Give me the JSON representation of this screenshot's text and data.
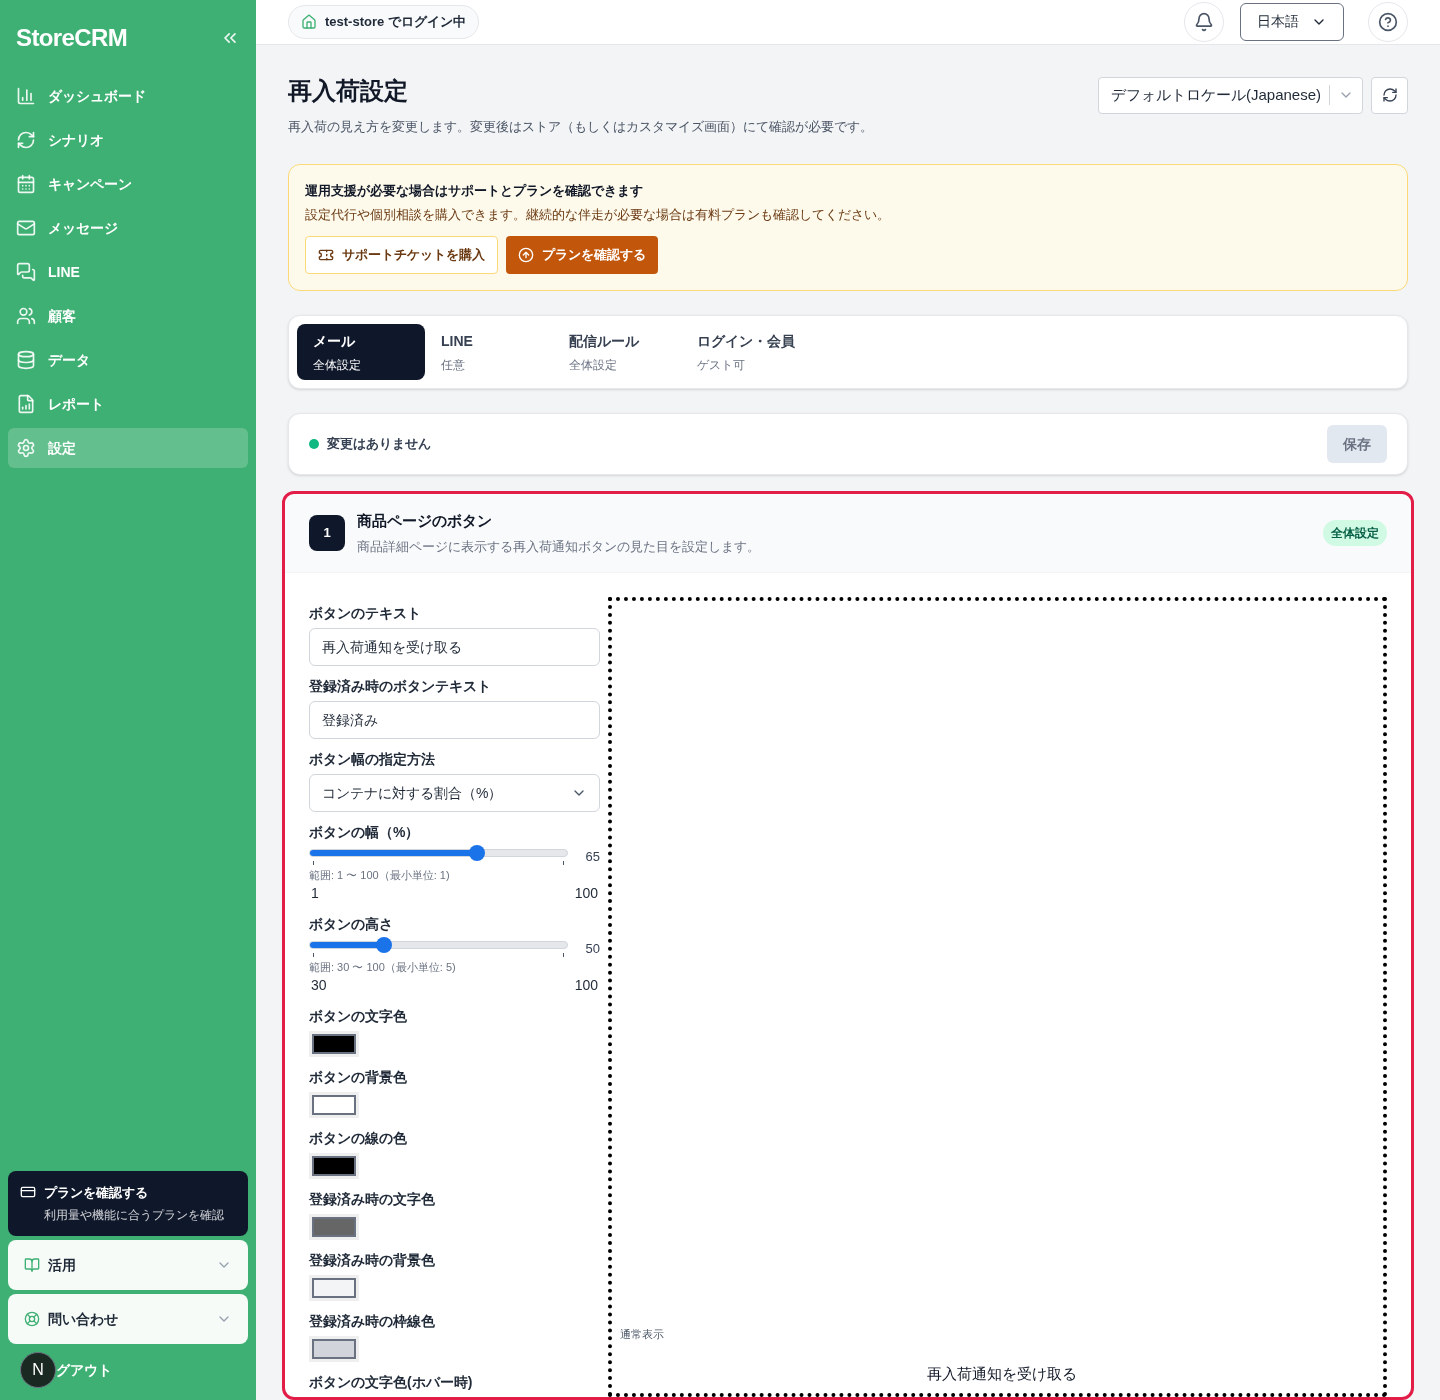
{
  "sidebar": {
    "logo": "StoreCRM",
    "items": [
      {
        "label": "ダッシュボード",
        "selected": false
      },
      {
        "label": "シナリオ",
        "selected": false
      },
      {
        "label": "キャンペーン",
        "selected": false
      },
      {
        "label": "メッセージ",
        "selected": false
      },
      {
        "label": "LINE",
        "selected": false
      },
      {
        "label": "顧客",
        "selected": false
      },
      {
        "label": "データ",
        "selected": false
      },
      {
        "label": "レポート",
        "selected": false
      },
      {
        "label": "設定",
        "selected": true
      }
    ],
    "plan_card": {
      "title": "プランを確認する",
      "subtitle": "利用量や機能に合うプランを確認"
    },
    "accordions": [
      {
        "label": "活用",
        "expanded": false
      },
      {
        "label": "問い合わせ",
        "expanded": false
      }
    ],
    "avatar": "N",
    "logout": "グアウト"
  },
  "header": {
    "store_badge": "test-store でログイン中",
    "language": "日本語"
  },
  "page": {
    "title": "再入荷設定",
    "description": "再入荷の見え方を変更します。変更後はストア（もしくはカスタマイズ画面）にて確認が必要です。",
    "locale_select": "デフォルトロケール(Japanese)"
  },
  "notice": {
    "title": "運用支援が必要な場合はサポートとプランを確認できます",
    "body": "設定代行や個別相談を購入できます。継続的な伴走が必要な場合は有料プランも確認してください。",
    "buttons": [
      {
        "label": "サポートチケットを購入",
        "kind": "outline"
      },
      {
        "label": "プランを確認する",
        "kind": "primary"
      }
    ]
  },
  "tabs": [
    {
      "title": "メール",
      "subtitle": "全体設定",
      "selected": true
    },
    {
      "title": "LINE",
      "subtitle": "任意",
      "selected": false
    },
    {
      "title": "配信ルール",
      "subtitle": "全体設定",
      "selected": false
    },
    {
      "title": "ログイン・会員",
      "subtitle": "ゲスト可",
      "selected": false
    }
  ],
  "status": {
    "text": "変更はありません",
    "color": "#10b981",
    "save": "保存",
    "disabled": true
  },
  "section": {
    "number": "1",
    "title": "商品ページのボタン",
    "description": "商品詳細ページに表示する再入荷通知ボタンの見た目を設定します。",
    "badge": "全体設定",
    "fields": [
      {
        "kind": "text",
        "label": "ボタンのテキスト",
        "value": "再入荷通知を受け取る"
      },
      {
        "kind": "text",
        "label": "登録済み時のボタンテキスト",
        "value": "登録済み"
      },
      {
        "kind": "select",
        "label": "ボタン幅の指定方法",
        "value": "コンテナに対する割合（%）"
      },
      {
        "kind": "slider",
        "label": "ボタンの幅（%）",
        "level": 0.65,
        "reading": "65",
        "range": "範囲: 1 〜 100（最小単位: 1)",
        "min": "1",
        "max": "100"
      },
      {
        "kind": "slider",
        "label": "ボタンの高さ",
        "level": 0.286,
        "reading": "50",
        "range": "範囲: 30 〜 100（最小単位: 5)",
        "min": "30",
        "max": "100"
      },
      {
        "kind": "color",
        "label": "ボタンの文字色",
        "color": "#000000"
      },
      {
        "kind": "color",
        "label": "ボタンの背景色",
        "color": "#ffffff"
      },
      {
        "kind": "color",
        "label": "ボタンの線の色",
        "color": "#000000"
      },
      {
        "kind": "color",
        "label": "登録済み時の文字色",
        "color": "#666666"
      },
      {
        "kind": "color",
        "label": "登録済み時の背景色",
        "color": "#f3f4f6"
      },
      {
        "kind": "color",
        "label": "登録済み時の枠線色",
        "color": "#d1d5db"
      },
      {
        "kind": "heading",
        "label": "ボタンの文字色(ホバー時)"
      }
    ],
    "preview": {
      "label": "通常表示",
      "button": "再入荷通知を受け取る"
    }
  }
}
